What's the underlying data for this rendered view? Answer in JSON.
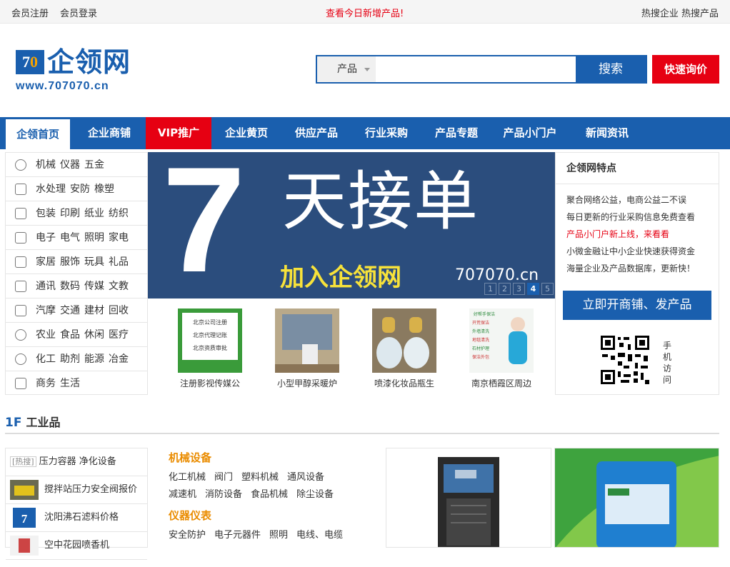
{
  "topbar": {
    "register": "会员注册",
    "login": "会员登录",
    "today_new": "查看今日新增产品!",
    "hot_company": "热搜企业",
    "hot_product": "热搜产品"
  },
  "logo": {
    "mark_7": "7",
    "mark_0": "0",
    "name": "企领网",
    "url": "www.707070.cn"
  },
  "search": {
    "category": "产品",
    "query": "",
    "button": "搜索",
    "ask_button": "快速询价"
  },
  "nav": [
    "企领首页",
    "企业商铺",
    "VIP推广",
    "企业黄页",
    "供应产品",
    "行业采购",
    "产品专题",
    "产品小门户",
    "新闻资讯"
  ],
  "categories": [
    {
      "icon": "gear-icon",
      "items": [
        "机械",
        "仪器",
        "五金"
      ]
    },
    {
      "icon": "sliders-icon",
      "items": [
        "水处理",
        "安防",
        "橡塑"
      ]
    },
    {
      "icon": "package-icon",
      "items": [
        "包装",
        "印刷",
        "纸业",
        "纺织"
      ]
    },
    {
      "icon": "tv-icon",
      "items": [
        "电子",
        "电气",
        "照明",
        "家电"
      ]
    },
    {
      "icon": "shirt-icon",
      "items": [
        "家居",
        "服饰",
        "玩具",
        "礼品"
      ]
    },
    {
      "icon": "printer-icon",
      "items": [
        "通讯",
        "数码",
        "传媒",
        "文教"
      ]
    },
    {
      "icon": "bar-chart-icon",
      "items": [
        "汽摩",
        "交通",
        "建材",
        "回收"
      ]
    },
    {
      "icon": "apple-icon",
      "items": [
        "农业",
        "食品",
        "休闲",
        "医疗"
      ]
    },
    {
      "icon": "chemistry-icon",
      "items": [
        "化工",
        "助剂",
        "能源",
        "冶金"
      ]
    },
    {
      "icon": "monitor-icon",
      "items": [
        "商务",
        "生活"
      ]
    }
  ],
  "banner": {
    "big_number": "7",
    "headline": "天接单",
    "join": "加入企领网",
    "site": "707070.cn",
    "slides": [
      "1",
      "2",
      "3",
      "4",
      "5"
    ],
    "active_slide": 4
  },
  "thumbs": [
    {
      "caption": "注册影视传媒公",
      "img_lines": [
        "北京公司注册",
        "北京代理记账",
        "北京资质审批"
      ]
    },
    {
      "caption": "小型甲醇采暖炉"
    },
    {
      "caption": "喷漆化妆品瓶生"
    },
    {
      "caption": "南京栖霞区周边",
      "img_lines": [
        "好帮手保洁",
        "开荒保洁",
        "外墙清洗",
        "地毯清洗",
        "石材护理",
        "保洁外包"
      ]
    }
  ],
  "features": {
    "title": "企领网特点",
    "lines": [
      {
        "text": "聚合网络公益，电商公益二不误",
        "red": false
      },
      {
        "text": "每日更新的行业采购信息免费查看",
        "red": false
      },
      {
        "text": "产品小门户新上线，来看看",
        "red": true
      },
      {
        "text": "小微金融让中小企业快速获得资金",
        "red": false
      },
      {
        "text": "海量企业及产品数据库，更新快！",
        "red": false
      }
    ],
    "open_button": "立即开商铺、发产品",
    "mobile": "手机访问"
  },
  "floor": {
    "num": "1F",
    "title": "工业品"
  },
  "hot": {
    "tag": "[热搜]",
    "first": "压力容器 净化设备",
    "items": [
      "搅拌站压力安全阀报价",
      "沈阳沸石滤料价格",
      "空中花园喷香机"
    ]
  },
  "industry": [
    {
      "title": "机械设备",
      "links": [
        [
          "化工机械",
          "阀门",
          "塑料机械",
          "通风设备"
        ],
        [
          "减速机",
          "消防设备",
          "食品机械",
          "除尘设备"
        ]
      ]
    },
    {
      "title": "仪器仪表",
      "links": [
        [
          "安全防护",
          "电子元器件",
          "照明",
          "电线、电缆"
        ]
      ]
    }
  ],
  "colors": {
    "brand": "#1a5fae",
    "accent": "#e60012",
    "orange": "#ea8c00"
  }
}
